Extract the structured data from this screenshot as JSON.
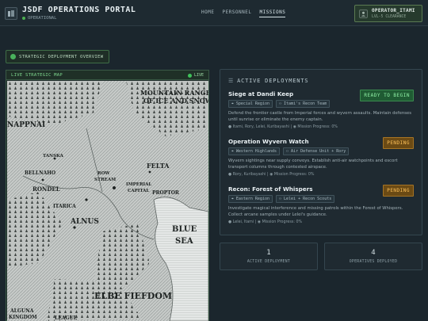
{
  "header": {
    "title": "JSDF OPERATIONS PORTAL",
    "status": "OPERATIONAL",
    "nav": [
      "HOME",
      "PERSONNEL",
      "MISSIONS"
    ],
    "active_nav": "MISSIONS",
    "user": {
      "name": "OPERATOR_ITAMI",
      "clearance": "LVL-5 CLEARANCE"
    }
  },
  "overview_label": "STRATEGIC DEPLOYMENT OVERVIEW",
  "map": {
    "label": "LIVE STRATEGIC MAP",
    "live": "LIVE",
    "places": {
      "mountain1": "MOUNTAIN RANGE",
      "mountain2": "OF ICE AND SNOW",
      "napnai": "NAPPNAI",
      "felta": "FELTA",
      "tanska": "TANSKA",
      "bellnaho": "BELLNAHO",
      "rowstream1": "ROW",
      "rowstream2": "STREAM",
      "imperial1": "IMPERIAL",
      "imperial2": "CAPITAL",
      "rondel": "RONDEL",
      "proptor": "PROPTOR",
      "itarica": "ITARICA",
      "alnus": "ALNUS",
      "blue": "BLUE",
      "sea": "SEA",
      "elbe": "ELBE FIEFDOM",
      "alguna1": "ALGUNA",
      "alguna2": "KINGDOM",
      "league": "LEAGUE"
    }
  },
  "deployments": {
    "title": "ACTIVE DEPLOYMENTS",
    "missions": [
      {
        "name": "Siege at Dandi Keep",
        "tags": [
          "Special Region",
          "Itami's Recon Team"
        ],
        "description": "Defend the frontier castle from Imperial forces and wyvern assaults. Maintain defenses until sunrise or eliminate the enemy captain.",
        "personnel": "Itami, Rory, Lelei, Kuribayashi",
        "progress": "Mission Progress: 0%",
        "status": "READY TO BEGIN"
      },
      {
        "name": "Operation Wyvern Watch",
        "tags": [
          "Western Highlands",
          "Air Defense Unit + Rory"
        ],
        "description": "Wyvern sightings near supply convoys. Establish anti-air watchpoints and escort transport columns through contested airspace.",
        "personnel": "Rory, Kuribayashi",
        "progress": "Mission Progress: 0%",
        "status": "PENDING"
      },
      {
        "name": "Recon: Forest of Whispers",
        "tags": [
          "Eastern Region",
          "Lelei + Recon Scouts"
        ],
        "description": "Investigate magical interference and missing patrols within the Forest of Whispers. Collect arcane samples under Lelei's guidance.",
        "personnel": "Lelei, Itami",
        "progress": "Mission Progress: 0%",
        "status": "PENDING"
      }
    ]
  },
  "stats": [
    {
      "value": "1",
      "label": "ACTIVE DEPLOYMENT"
    },
    {
      "value": "4",
      "label": "OPERATIVES DEPLOYED"
    }
  ],
  "colors": {
    "background": "#1b262d",
    "accent_green": "#49b25c",
    "ready": "#1f5b33",
    "pending": "#6b4a14"
  }
}
